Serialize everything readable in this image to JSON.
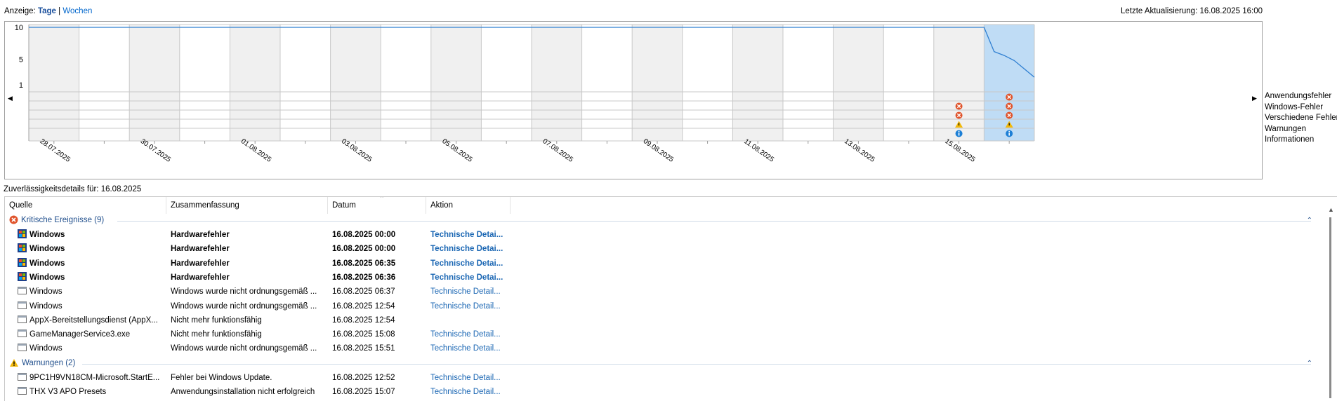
{
  "top": {
    "view_label": "Anzeige:",
    "days": "Tage",
    "separator": "|",
    "weeks": "Wochen",
    "last_update": "Letzte Aktualisierung: 16.08.2025 16:00"
  },
  "graph": {
    "y_ticks": [
      "10",
      "5",
      "1"
    ],
    "columns": 20,
    "dates": [
      "28.07.2025",
      "30.07.2025",
      "01.08.2025",
      "03.08.2025",
      "05.08.2025",
      "07.08.2025",
      "09.08.2025",
      "11.08.2025",
      "13.08.2025",
      "15.08.2025"
    ],
    "stability_index": [
      10,
      10,
      10,
      10,
      10,
      10,
      10,
      10,
      10,
      10,
      10,
      10,
      10,
      10,
      10,
      10,
      10,
      10,
      10,
      10,
      6.2,
      5.6,
      4.8,
      3.5,
      2.2
    ],
    "selected_column": 19,
    "legend": [
      "Anwendungsfehler",
      "Windows-Fehler",
      "Verschiedene Fehler",
      "Warnungen",
      "Informationen"
    ],
    "markers": [
      {
        "column": 18,
        "row": 1,
        "kind": "error"
      },
      {
        "column": 18,
        "row": 2,
        "kind": "error"
      },
      {
        "column": 18,
        "row": 3,
        "kind": "warning"
      },
      {
        "column": 18,
        "row": 4,
        "kind": "info"
      },
      {
        "column": 19,
        "row": 0,
        "kind": "error"
      },
      {
        "column": 19,
        "row": 1,
        "kind": "error"
      },
      {
        "column": 19,
        "row": 2,
        "kind": "error"
      },
      {
        "column": 19,
        "row": 3,
        "kind": "warning"
      },
      {
        "column": 19,
        "row": 4,
        "kind": "info"
      }
    ],
    "colors": {
      "line": "#2f7fd1",
      "selected": "#bfdcf5",
      "shaded": "#f0f0f0",
      "error": "#e0542c",
      "warning": "#f2b90c",
      "info": "#1c7fd6"
    }
  },
  "details": {
    "title": "Zuverlässigkeitsdetails für: 16.08.2025",
    "columns": [
      "Quelle",
      "Zusammenfassung",
      "Datum",
      "Aktion"
    ],
    "groups": [
      {
        "label": "Kritische Ereignisse (9)",
        "icon": "error-icon",
        "rows": [
          {
            "source": "Windows",
            "summary": "Hardwarefehler",
            "date": "16.08.2025 00:00",
            "action": "Technische Detai...",
            "bold": true,
            "icon": "windows-flag-icon"
          },
          {
            "source": "Windows",
            "summary": "Hardwarefehler",
            "date": "16.08.2025 00:00",
            "action": "Technische Detai...",
            "bold": true,
            "icon": "windows-flag-icon"
          },
          {
            "source": "Windows",
            "summary": "Hardwarefehler",
            "date": "16.08.2025 06:35",
            "action": "Technische Detai...",
            "bold": true,
            "icon": "windows-flag-icon"
          },
          {
            "source": "Windows",
            "summary": "Hardwarefehler",
            "date": "16.08.2025 06:36",
            "action": "Technische Detai...",
            "bold": true,
            "icon": "windows-flag-icon"
          },
          {
            "source": "Windows",
            "summary": "Windows wurde nicht ordnungsgemäß ...",
            "date": "16.08.2025 06:37",
            "action": "Technische Detail...",
            "bold": false,
            "icon": "app-window-icon"
          },
          {
            "source": "Windows",
            "summary": "Windows wurde nicht ordnungsgemäß ...",
            "date": "16.08.2025 12:54",
            "action": "Technische Detail...",
            "bold": false,
            "icon": "app-window-icon"
          },
          {
            "source": "AppX-Bereitstellungsdienst (AppX...",
            "summary": "Nicht mehr funktionsfähig",
            "date": "16.08.2025 12:54",
            "action": "",
            "bold": false,
            "icon": "app-window-icon"
          },
          {
            "source": "GameManagerService3.exe",
            "summary": "Nicht mehr funktionsfähig",
            "date": "16.08.2025 15:08",
            "action": "Technische Detail...",
            "bold": false,
            "icon": "app-window-icon"
          },
          {
            "source": "Windows",
            "summary": "Windows wurde nicht ordnungsgemäß ...",
            "date": "16.08.2025 15:51",
            "action": "Technische Detail...",
            "bold": false,
            "icon": "app-window-icon"
          }
        ]
      },
      {
        "label": "Warnungen (2)",
        "icon": "warning-icon",
        "rows": [
          {
            "source": "9PC1H9VN18CM-Microsoft.StartE...",
            "summary": "Fehler bei Windows Update.",
            "date": "16.08.2025 12:52",
            "action": "Technische Detail...",
            "bold": false,
            "icon": "app-window-icon"
          },
          {
            "source": "THX V3 APO Presets",
            "summary": "Anwendungsinstallation nicht erfolgreich",
            "date": "16.08.2025 15:07",
            "action": "Technische Detail...",
            "bold": false,
            "icon": "app-window-icon"
          }
        ]
      }
    ]
  }
}
